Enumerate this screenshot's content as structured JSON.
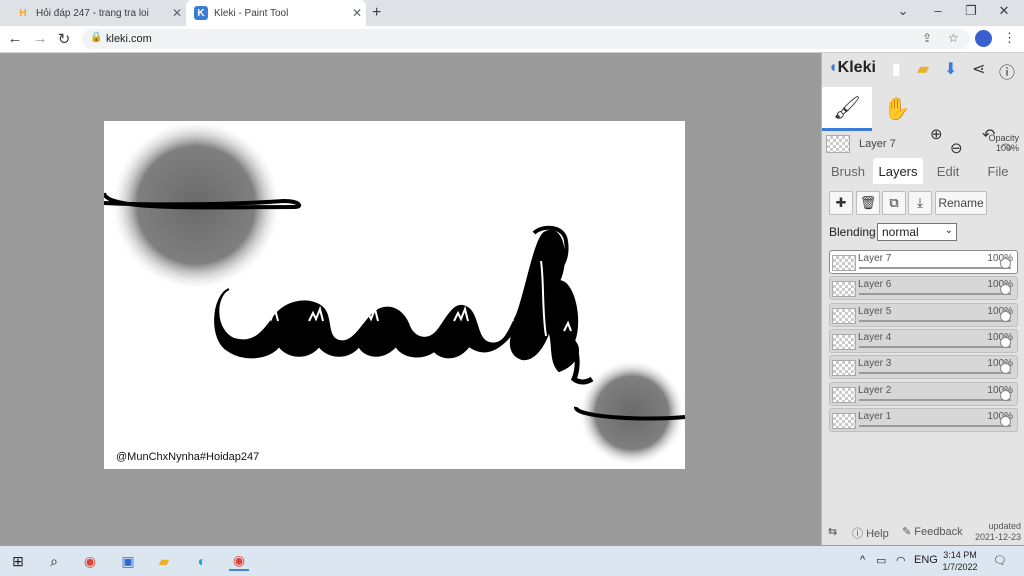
{
  "browser": {
    "tabs": [
      {
        "title": "Hỏi đáp 247 - trang tra loi",
        "favicon": "H"
      },
      {
        "title": "Kleki - Paint Tool",
        "favicon": "K"
      }
    ],
    "new_tab_glyph": "+",
    "url": "kleki.com"
  },
  "canvas": {
    "watermark": "@MunChxNynha#Hoidap247"
  },
  "app": {
    "logo": "Kleki",
    "current_layer": {
      "name": "Layer 7",
      "opacity_label": "Opacity",
      "opacity_value": "100%"
    },
    "tabs": [
      "Brush",
      "Layers",
      "Edit",
      "File"
    ],
    "active_tab": "Layers",
    "rename_label": "Rename",
    "blending_label": "Blending",
    "blending_value": "normal",
    "layers": [
      {
        "name": "Layer 7",
        "opacity": "100%",
        "level": 1.0
      },
      {
        "name": "Layer 6",
        "opacity": "100%",
        "level": 1.0
      },
      {
        "name": "Layer 5",
        "opacity": "100%",
        "level": 1.0
      },
      {
        "name": "Layer 4",
        "opacity": "100%",
        "level": 1.0
      },
      {
        "name": "Layer 3",
        "opacity": "100%",
        "level": 1.0
      },
      {
        "name": "Layer 2",
        "opacity": "100%",
        "level": 1.0
      },
      {
        "name": "Layer 1",
        "opacity": "100%",
        "level": 1.0
      }
    ],
    "footer": {
      "help": "Help",
      "feedback": "Feedback",
      "updated_label": "updated",
      "updated_date": "2021-12-23"
    }
  },
  "taskbar": {
    "lang": "ENG",
    "time": "3:14 PM",
    "date": "1/7/2022"
  },
  "colors": {
    "accent": "#3c7bd6",
    "canvas_bg": "#9b9b9b"
  }
}
